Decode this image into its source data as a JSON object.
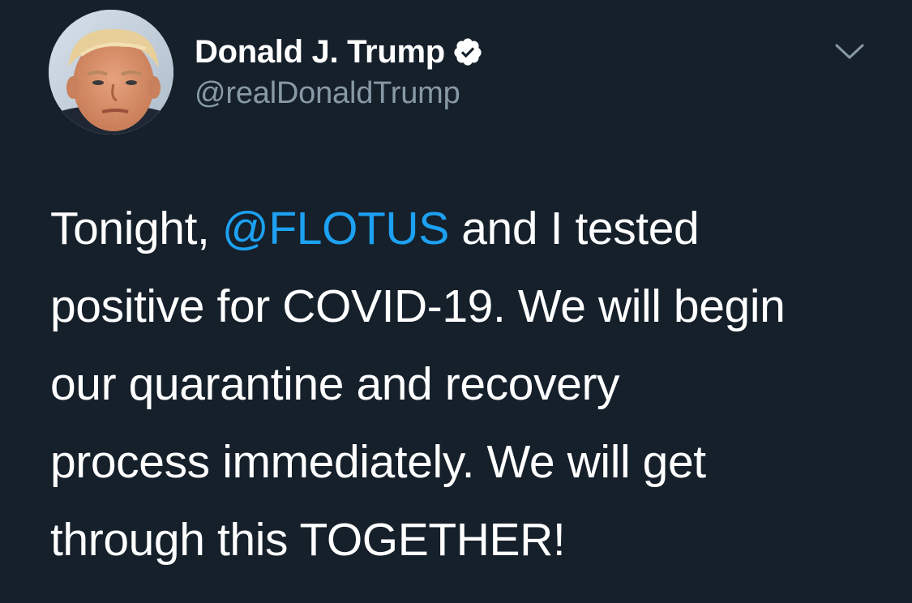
{
  "tweet": {
    "author": {
      "display_name": "Donald J. Trump",
      "handle": "@realDonaldTrump",
      "verified_icon": "verified-badge-icon"
    },
    "menu_icon": "chevron-down-icon",
    "text": {
      "line1_before": "Tonight, ",
      "mention": "@FLOTUS",
      "line1_after": " and I tested",
      "line2": "positive for COVID-19. We will begin",
      "line3": "our quarantine and recovery",
      "line4": "process immediately. We will get",
      "line5": "through this TOGETHER!"
    }
  },
  "colors": {
    "background": "#15202b",
    "text": "#ffffff",
    "secondary_text": "#8899a6",
    "link": "#1da1f2"
  }
}
